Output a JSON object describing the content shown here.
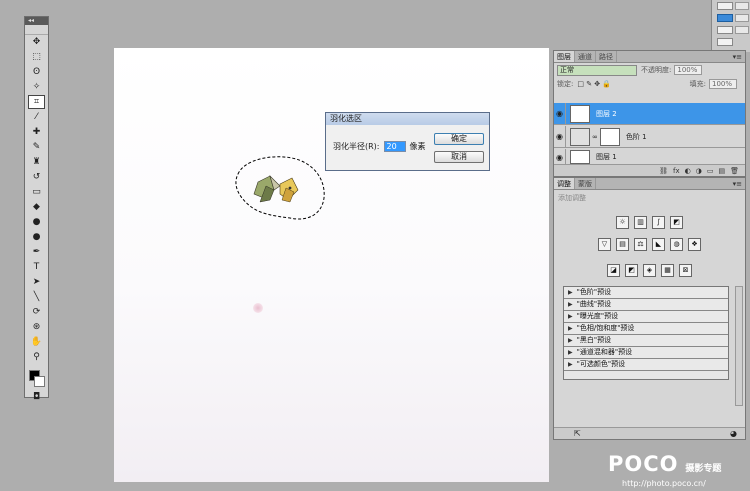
{
  "toolbox": {
    "header": "◂◂",
    "tools": [
      {
        "name": "move-tool",
        "glyph": "✥"
      },
      {
        "name": "marquee-tool",
        "glyph": "⬚"
      },
      {
        "name": "lasso-tool",
        "glyph": "ʘ"
      },
      {
        "name": "magic-wand-tool",
        "glyph": "✧"
      },
      {
        "name": "crop-tool",
        "glyph": "⌗",
        "active": true
      },
      {
        "name": "eyedropper-tool",
        "glyph": "⁄"
      },
      {
        "name": "healing-brush-tool",
        "glyph": "✚"
      },
      {
        "name": "brush-tool",
        "glyph": "✎"
      },
      {
        "name": "clone-stamp-tool",
        "glyph": "♜"
      },
      {
        "name": "history-brush-tool",
        "glyph": "↺"
      },
      {
        "name": "eraser-tool",
        "glyph": "▭"
      },
      {
        "name": "paint-bucket-tool",
        "glyph": "◆"
      },
      {
        "name": "blur-tool",
        "glyph": "●"
      },
      {
        "name": "dodge-tool",
        "glyph": "●"
      },
      {
        "name": "pen-tool",
        "glyph": "✒"
      },
      {
        "name": "type-tool",
        "glyph": "T"
      },
      {
        "name": "path-selection-tool",
        "glyph": "➤"
      },
      {
        "name": "line-tool",
        "glyph": "╲"
      },
      {
        "name": "3d-rotate-tool",
        "glyph": "⟳"
      },
      {
        "name": "3d-orbit-tool",
        "glyph": "⊛"
      },
      {
        "name": "hand-tool",
        "glyph": "✋"
      },
      {
        "name": "zoom-tool",
        "glyph": "⚲"
      }
    ],
    "foreground_color": "#000000",
    "background_color": "#ffffff"
  },
  "dialog": {
    "title": "羽化选区",
    "radius_label": "羽化半径(R):",
    "radius_value": "20",
    "unit": "像素",
    "ok_label": "确定",
    "cancel_label": "取消"
  },
  "layers_panel": {
    "tabs": [
      "图层",
      "通道",
      "路径"
    ],
    "menu": "▾≡",
    "blend_mode": "正常",
    "opacity_label": "不透明度:",
    "opacity_value": "100%",
    "lock_label": "锁定:",
    "fill_label": "填充:",
    "fill_value": "100%",
    "layers": [
      {
        "name": "图层 2",
        "selected": true
      },
      {
        "name": "色阶 1",
        "selected": false
      },
      {
        "name": "图层 1",
        "selected": false
      }
    ],
    "footer_icons": [
      "⛓",
      "fx",
      "◐",
      "◑",
      "▭",
      "▤",
      "🗑"
    ]
  },
  "adjustments_panel": {
    "tabs": [
      "调整",
      "蒙版"
    ],
    "menu": "▾≡",
    "hint": "添加调整",
    "icon_rows": [
      [
        "☼",
        "▥",
        "∫",
        "◩"
      ],
      [
        "▽",
        "▤",
        "⚖",
        "◣",
        "◍",
        "❖"
      ],
      [
        "◪",
        "◩",
        "◈",
        "▦",
        "⊠"
      ]
    ],
    "presets": [
      "\"色阶\"预设",
      "\"曲线\"预设",
      "\"曝光度\"预设",
      "\"色相/饱和度\"预设",
      "\"黑白\"预设",
      "\"通道混和器\"预设",
      "\"可选颜色\"预设"
    ]
  },
  "watermark": {
    "main": "POCO",
    "sub": "摄影专题",
    "url": "http://photo.poco.cn/"
  }
}
